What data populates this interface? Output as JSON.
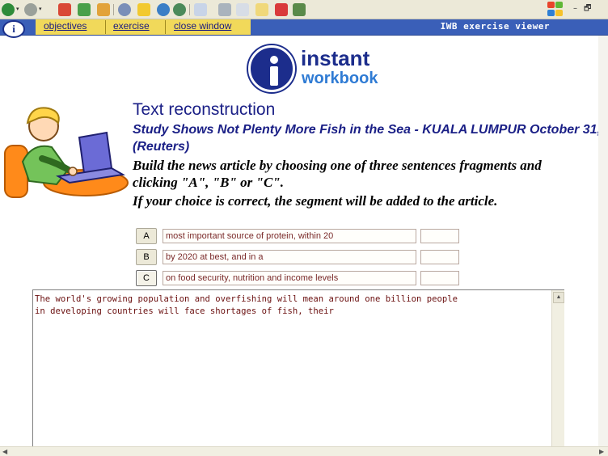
{
  "browser": {
    "toolbar_icons": [
      "back-icon",
      "forward-icon",
      "stop-icon",
      "refresh-icon",
      "home-icon",
      "search-icon",
      "favorites-icon",
      "media-icon",
      "history-icon",
      "mail-icon",
      "print-icon",
      "edit-icon",
      "discuss-icon",
      "messenger-icon",
      "research-icon"
    ],
    "window_buttons": [
      "–",
      "🗗"
    ]
  },
  "iwb": {
    "tabs": [
      "objectives",
      "exercise",
      "close window"
    ],
    "title": "IWB exercise viewer",
    "colors": {
      "bar": "#3a5fb8",
      "tabs": "#f1d95a"
    }
  },
  "logo": {
    "word1": "instant",
    "word2": "workbook"
  },
  "exercise": {
    "title": "Text reconstruction",
    "headline": "Study Shows Not Plenty More Fish in the Sea - KUALA LUMPUR October 31, (Reuters)",
    "instruction_line1": "Build the news article by choosing one of three sentences fragments and",
    "instruction_line2": "clicking \"A\", \"B\" or \"C\".",
    "instruction_line3": "If your choice is correct, the segment will be added to the article.",
    "options": [
      {
        "label": "A",
        "text": "most important source of protein, within 20"
      },
      {
        "label": "B",
        "text": "by 2020 at best, and in a"
      },
      {
        "label": "C",
        "text": "on food security, nutrition and income levels"
      }
    ],
    "article_text": "The world's growing population and overfishing will mean around one billion people\nin developing countries will face shortages of fish, their"
  }
}
